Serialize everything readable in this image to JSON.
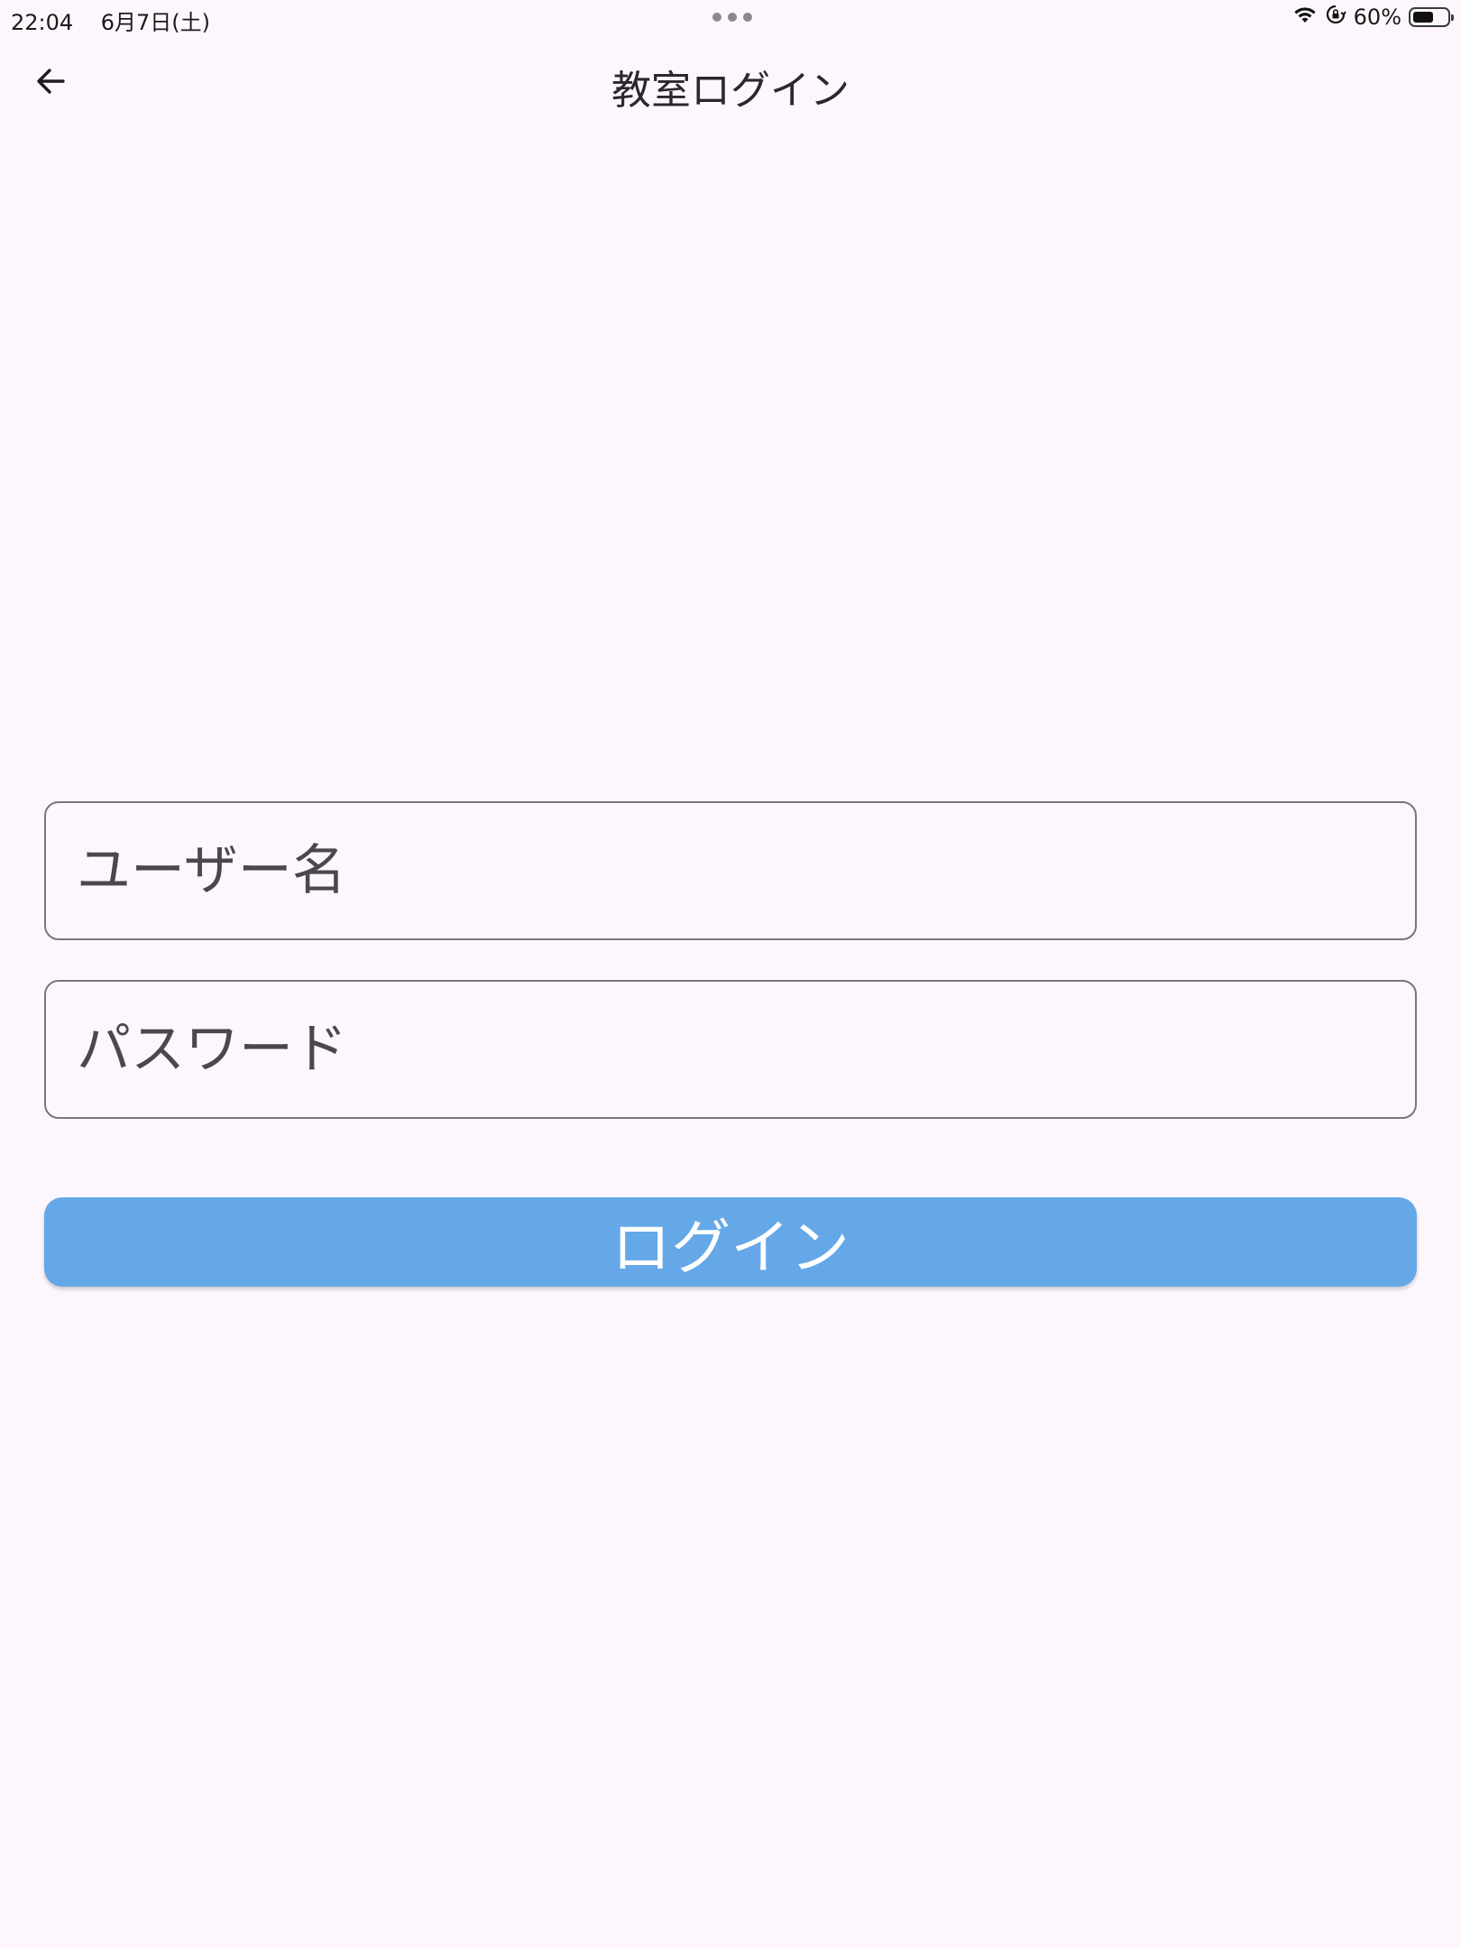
{
  "status_bar": {
    "time": "22:04",
    "date": "6月7日(土)",
    "battery_percent": "60%",
    "battery_level": 0.6,
    "icons": [
      "wifi-icon",
      "orientation-lock-icon",
      "battery-icon"
    ]
  },
  "app_bar": {
    "back_icon": "arrow-left-icon",
    "title": "教室ログイン"
  },
  "form": {
    "username_placeholder": "ユーザー名",
    "username_value": "",
    "password_placeholder": "パスワード",
    "password_value": "",
    "login_label": "ログイン"
  },
  "colors": {
    "background": "#fdf7fd",
    "button": "#64a8e8",
    "button_text": "#ffffff",
    "field_border": "#7a747c"
  }
}
